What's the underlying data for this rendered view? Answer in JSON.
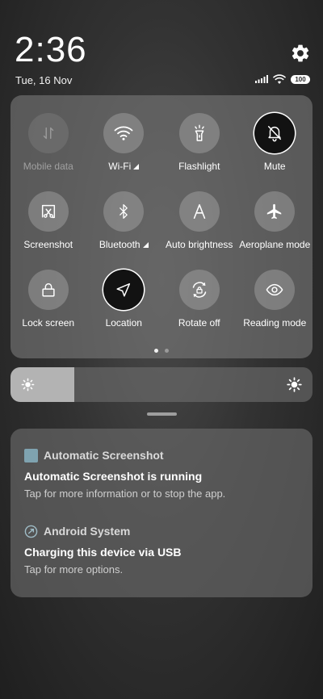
{
  "status": {
    "time": "2:36",
    "date": "Tue, 16 Nov",
    "battery": "100"
  },
  "quick_settings": {
    "tiles": [
      {
        "label": "Mobile data",
        "icon": "mobile-data-icon",
        "state": "disabled"
      },
      {
        "label": "Wi-Fi",
        "icon": "wifi-icon",
        "state": "off"
      },
      {
        "label": "Flashlight",
        "icon": "flashlight-icon",
        "state": "off"
      },
      {
        "label": "Mute",
        "icon": "bell-off-icon",
        "state": "on"
      },
      {
        "label": "Screenshot",
        "icon": "screenshot-icon",
        "state": "off"
      },
      {
        "label": "Bluetooth",
        "icon": "bluetooth-icon",
        "state": "off"
      },
      {
        "label": "Auto brightness",
        "icon": "auto-brightness-icon",
        "state": "off"
      },
      {
        "label": "Aeroplane mode",
        "icon": "airplane-icon",
        "state": "off"
      },
      {
        "label": "Lock screen",
        "icon": "lock-icon",
        "state": "off"
      },
      {
        "label": "Location",
        "icon": "location-arrow-icon",
        "state": "on"
      },
      {
        "label": "Rotate off",
        "icon": "rotate-lock-icon",
        "state": "off"
      },
      {
        "label": "Reading mode",
        "icon": "eye-icon",
        "state": "off"
      }
    ],
    "page_count": 2,
    "current_page": 1
  },
  "brightness": {
    "level": 0.21
  },
  "notifications": [
    {
      "app": "Automatic Screenshot",
      "title": "Automatic Screenshot is running",
      "body": "Tap for more information or to stop the app."
    },
    {
      "app": "Android System",
      "title": "Charging this device via USB",
      "body": "Tap for more options."
    }
  ],
  "colors": {
    "active_tile": "#121212",
    "panel": "#787878",
    "app_square": "#7fa3b0"
  }
}
